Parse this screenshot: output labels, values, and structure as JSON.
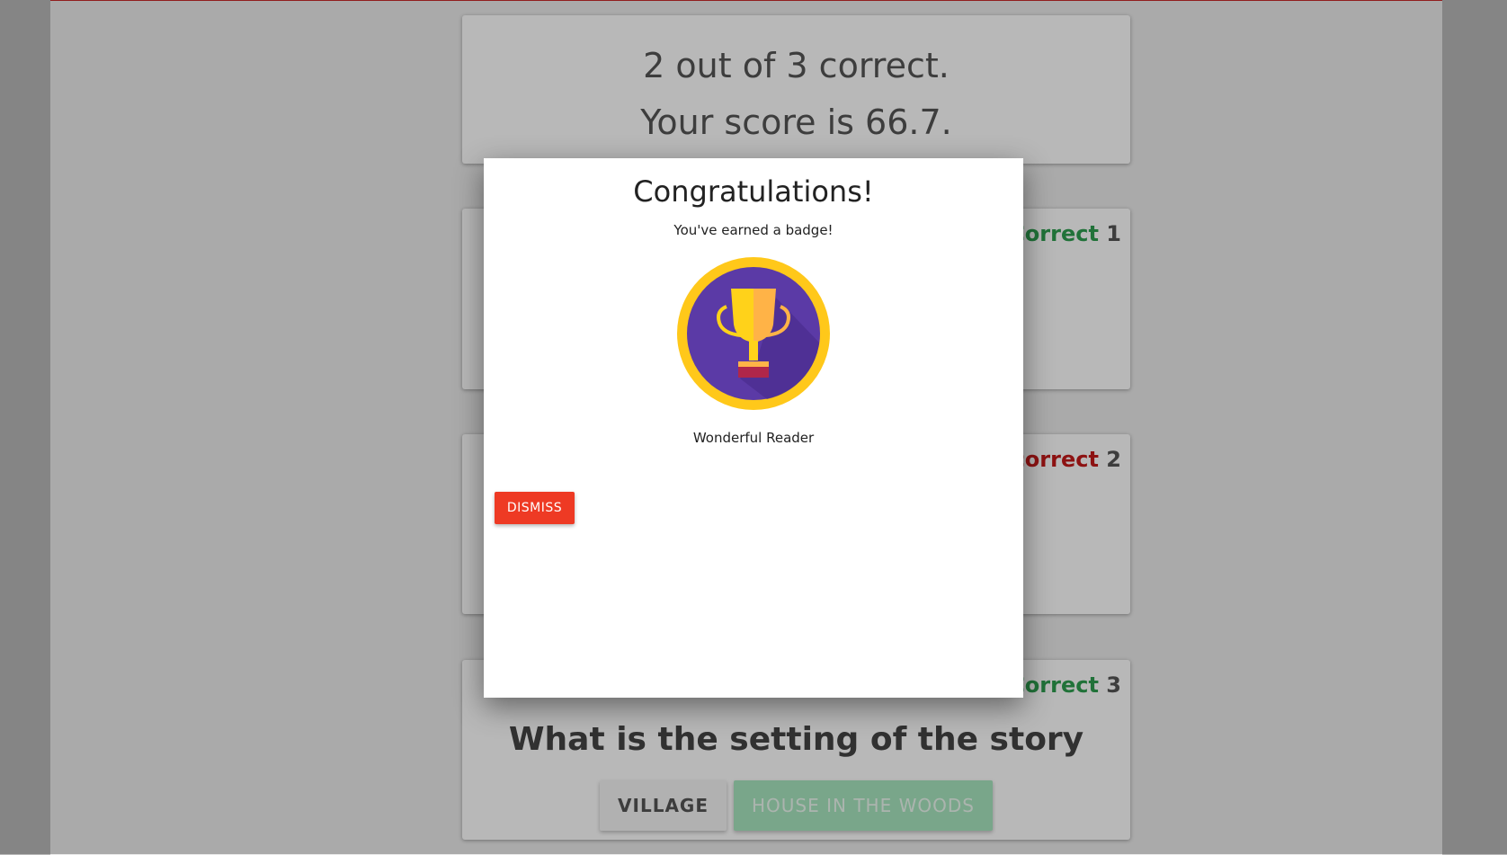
{
  "score": {
    "correct_line": "2 out of 3 correct.",
    "score_line": "Your score is 66.7."
  },
  "questions": [
    {
      "status": "Correct",
      "number": "1",
      "status_color": "#2e9e4f"
    },
    {
      "status": "Incorrect",
      "number": "2",
      "status_color": "#c41a1a"
    },
    {
      "status": "Correct",
      "number": "3",
      "status_color": "#2e9e4f",
      "text": "What is the setting of the story",
      "answers": [
        "VILLAGE",
        "HOUSE IN THE WOODS"
      ]
    }
  ],
  "modal": {
    "title": "Congratulations!",
    "subtitle": "You've earned a badge!",
    "badge_icon": "trophy-badge-icon",
    "badge_name": "Wonderful Reader",
    "dismiss_label": "DISMISS"
  },
  "colors": {
    "accent_red": "#ee3a24",
    "correct_green": "#2e9e4f",
    "incorrect_red": "#c41a1a",
    "badge_purple": "#5b3aa6",
    "badge_gold": "#ffc81a"
  }
}
